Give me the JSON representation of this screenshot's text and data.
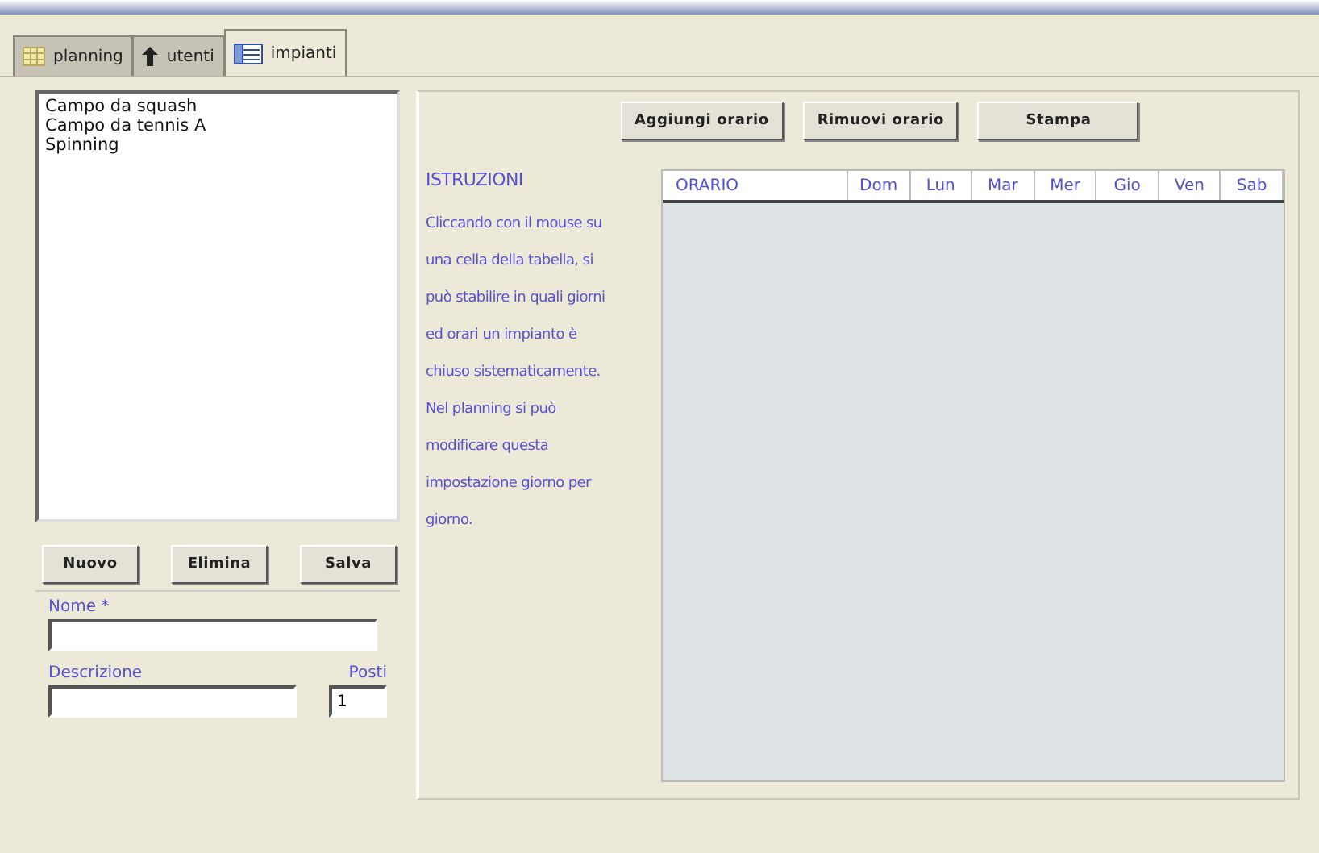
{
  "tabs": [
    {
      "label": "planning",
      "selected": false
    },
    {
      "label": "utenti",
      "selected": false
    },
    {
      "label": "impianti",
      "selected": true
    }
  ],
  "facilities": [
    {
      "label": "Campo da squash",
      "selected": false
    },
    {
      "label": "Campo da tennis A",
      "selected": false
    },
    {
      "label": "Spinning",
      "selected": false
    }
  ],
  "list_buttons": [
    "Nuovo",
    "Elimina",
    "Salva"
  ],
  "form": {
    "name_label": "Nome *",
    "description_label": "Descrizione",
    "seats_label": "Posti",
    "seats_value": "1"
  },
  "toolbar_buttons": [
    "Aggiungi orario",
    "Rimuovi orario",
    "Stampa"
  ],
  "instructions": {
    "title": "ISTRUZIONI",
    "text": "Cliccando con il mouse su una cella della tabella, si può stabilire in quali giorni ed orari un impianto è chiuso sistematicamente. Nel planning si può modificare questa impostazione giorno per giorno."
  },
  "table": {
    "columns": [
      "ORARIO",
      "Dom",
      "Lun",
      "Mar",
      "Mer",
      "Gio",
      "Ven",
      "Sab"
    ]
  }
}
